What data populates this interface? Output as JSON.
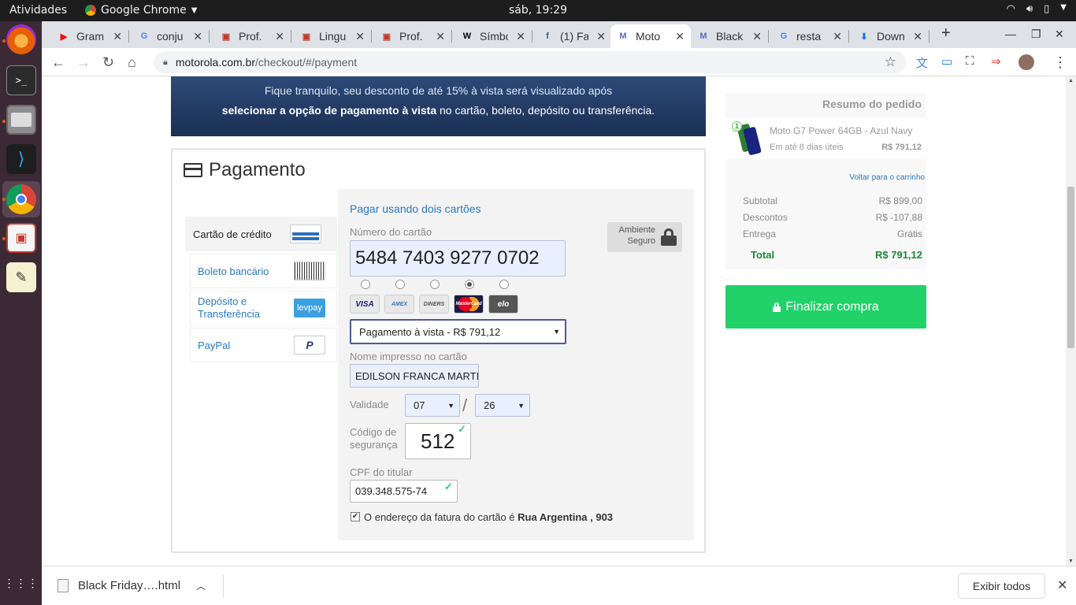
{
  "system": {
    "activities": "Atividades",
    "app_name": "Google Chrome",
    "clock": "sáb, 19:29"
  },
  "tabs": [
    {
      "title": "Gram",
      "icon": "youtube-icon",
      "color": "#ff0000",
      "glyph": "▶"
    },
    {
      "title": "conju",
      "icon": "google-icon",
      "color": "#4285f4",
      "glyph": "G"
    },
    {
      "title": "Prof.",
      "icon": "presentation-icon",
      "color": "#c0392b",
      "glyph": "▣"
    },
    {
      "title": "Lingu",
      "icon": "presentation-icon",
      "color": "#c0392b",
      "glyph": "▣"
    },
    {
      "title": "Prof.",
      "icon": "presentation-icon",
      "color": "#c0392b",
      "glyph": "▣"
    },
    {
      "title": "Símbo",
      "icon": "wikipedia-icon",
      "color": "#000000",
      "glyph": "W"
    },
    {
      "title": "(1) Fa",
      "icon": "facebook-icon",
      "color": "#3b5998",
      "glyph": "f"
    },
    {
      "title": "Moto",
      "icon": "motorola-icon",
      "color": "#5c6bc0",
      "glyph": "M"
    },
    {
      "title": "Black",
      "icon": "motorola-icon",
      "color": "#5c6bc0",
      "glyph": "M"
    },
    {
      "title": "resta",
      "icon": "google-icon",
      "color": "#4285f4",
      "glyph": "G"
    },
    {
      "title": "Down",
      "icon": "download-icon",
      "color": "#1a73e8",
      "glyph": "⬇"
    }
  ],
  "address": {
    "domain": "motorola.com.br",
    "path": "/checkout/#/payment"
  },
  "banner": {
    "line1": "Fique tranquilo, seu desconto de até 15% à vista será visualizado após",
    "line2_bold": "selecionar a opção de pagamento à vista",
    "line2_rest": " no cartão, boleto, depósito ou transferência."
  },
  "payment": {
    "title": "Pagamento",
    "methods": [
      {
        "label": "Cartão de crédito",
        "icon": "credit-card-icon"
      },
      {
        "label": "Boleto bancário",
        "icon": "barcode-icon"
      },
      {
        "label": "Depósito e Transferência",
        "icon": "levpay-icon",
        "icon_text": "levpay"
      },
      {
        "label": "PayPal",
        "icon": "paypal-icon",
        "icon_text": "P"
      }
    ],
    "two_cards_link": "Pagar usando dois cartões",
    "card_number_label": "Número do cartão",
    "card_number": "5484 7403 9277 0702",
    "secure_label_1": "Ambiente",
    "secure_label_2": "Seguro",
    "brands": [
      {
        "name": "VISA",
        "bg": "#e8e8e8",
        "fg": "#1a1f71"
      },
      {
        "name": "AMEX",
        "bg": "#e8e8e8",
        "fg": "#2e77bc"
      },
      {
        "name": "DINERS",
        "bg": "#e8e8e8",
        "fg": "#555555"
      },
      {
        "name": "MasterCard",
        "bg": "#1a1a4a",
        "fg": "#ffffff"
      },
      {
        "name": "elo",
        "bg": "#555555",
        "fg": "#ffffff"
      }
    ],
    "selected_brand_index": 3,
    "installments_value": "Pagamento à vista - R$ 791,12",
    "name_label": "Nome impresso no cartão",
    "name_value": "EDILSON FRANCA MARTINS",
    "validity_label": "Validade",
    "month": "07",
    "year": "26",
    "slash": "/",
    "cvv_label_1": "Código de",
    "cvv_label_2": "segurança",
    "cvv": "512",
    "cpf_label": "CPF do titular",
    "cpf": "039.348.575-74",
    "address_text": "O endereço da fatura do cartão é ",
    "address_bold": "Rua Argentina , 903"
  },
  "summary": {
    "title": "Resumo do pedido",
    "product_qty": "1",
    "product_name": "Moto G7 Power 64GB - Azul Navy",
    "delivery": "Em até 8 dias úteis",
    "product_price": "R$ 791,12",
    "back_link": "Voltar para o carrinho",
    "rows": [
      {
        "label": "Subtotal",
        "value": "R$ 899,00"
      },
      {
        "label": "Descontos",
        "value": "R$ -107,88"
      },
      {
        "label": "Entrega",
        "value": "Grátis"
      }
    ],
    "total_label": "Total",
    "total_value": "R$ 791,12",
    "finish_button": "Finalizar compra"
  },
  "downloads": {
    "file": "Black Friday….html",
    "show_all": "Exibir todos"
  },
  "colors": {
    "accent_green": "#21d16a",
    "link_blue": "#2a7ac0",
    "banner_navy": "#1b2f52"
  }
}
